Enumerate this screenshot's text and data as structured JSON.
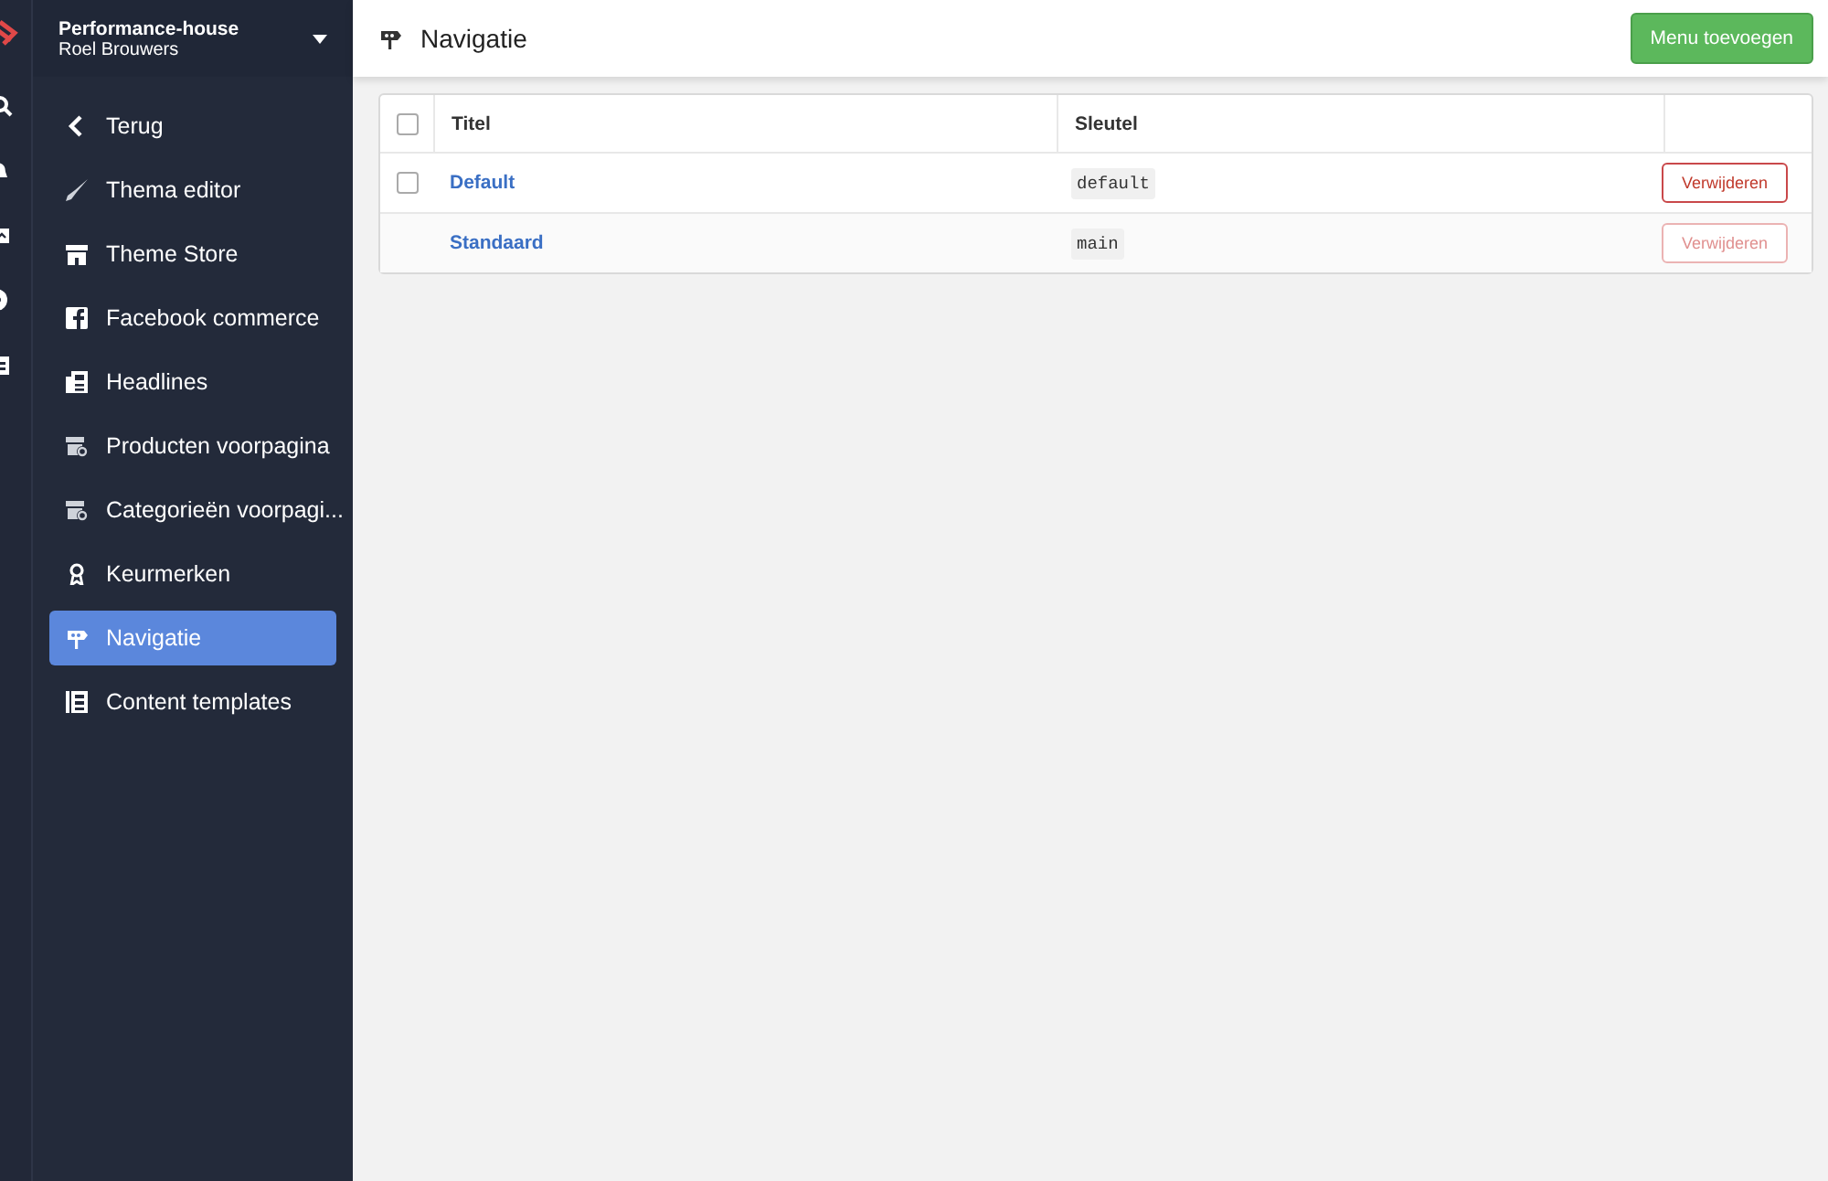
{
  "account": {
    "shop": "Performance-house",
    "user": "Roel Brouwers"
  },
  "sidebar": {
    "items": [
      {
        "label": "Terug",
        "kind": "back",
        "selected": false
      },
      {
        "label": "Thema editor",
        "kind": "link",
        "selected": false
      },
      {
        "label": "Theme Store",
        "kind": "link",
        "selected": false
      },
      {
        "label": "Facebook commerce",
        "kind": "link",
        "selected": false
      },
      {
        "label": "Headlines",
        "kind": "link",
        "selected": false
      },
      {
        "label": "Producten voorpagina",
        "kind": "link",
        "selected": false
      },
      {
        "label": "Categorieën voorpagi...",
        "kind": "link",
        "selected": false
      },
      {
        "label": "Keurmerken",
        "kind": "link",
        "selected": false
      },
      {
        "label": "Navigatie",
        "kind": "link",
        "selected": true
      },
      {
        "label": "Content templates",
        "kind": "link",
        "selected": false
      }
    ]
  },
  "header": {
    "title": "Navigatie",
    "button": "Menu toevoegen"
  },
  "table": {
    "columns": [
      "Titel",
      "Sleutel"
    ],
    "select_all": {
      "checked": false
    },
    "rows": [
      {
        "title": "Default",
        "key": "default",
        "selectable": true,
        "checked": false,
        "action": "Verwijderen",
        "disabled": false
      },
      {
        "title": "Standaard",
        "key": "main",
        "selectable": false,
        "action": "Verwijderen",
        "disabled": true
      }
    ]
  }
}
